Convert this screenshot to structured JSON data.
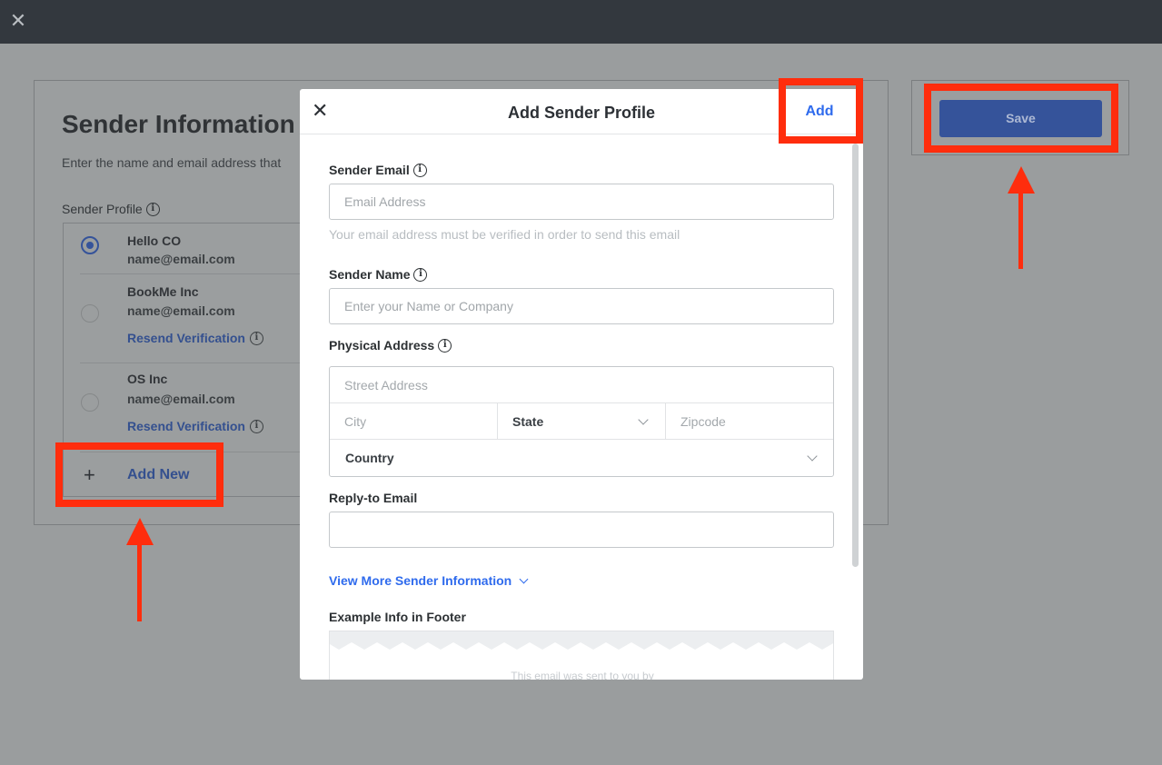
{
  "window": {
    "close_glyph": "✕"
  },
  "background": {
    "title": "Sender Information",
    "subtitle": "Enter the name and email address that",
    "profile_label": "Sender Profile",
    "profiles": [
      {
        "name": "Hello CO",
        "email": "name@email.com",
        "selected": true
      },
      {
        "name": "BookMe Inc",
        "email": "name@email.com",
        "resend": "Resend Verification"
      },
      {
        "name": "OS Inc",
        "email": "name@email.com",
        "resend": "Resend Verification"
      }
    ],
    "add_new_label": "Add New",
    "save_label": "Save"
  },
  "modal": {
    "title": "Add Sender Profile",
    "add_label": "Add",
    "sender_email_label": "Sender Email",
    "sender_email_placeholder": "Email Address",
    "sender_email_help": "Your email address must be verified in order to send this email",
    "sender_name_label": "Sender Name",
    "sender_name_placeholder": "Enter your Name or Company",
    "address_label": "Physical Address",
    "street_placeholder": "Street Address",
    "city_placeholder": "City",
    "state_value": "State",
    "zip_placeholder": "Zipcode",
    "country_value": "Country",
    "reply_to_label": "Reply-to Email",
    "reply_to_value": "",
    "view_more_label": "View More Sender Information",
    "footer_label": "Example Info in Footer",
    "footer_preview_text": "This email was sent to you by"
  },
  "colors": {
    "highlight": "#ff2d0d",
    "accent": "#2f6bed",
    "save": "#35539a"
  }
}
